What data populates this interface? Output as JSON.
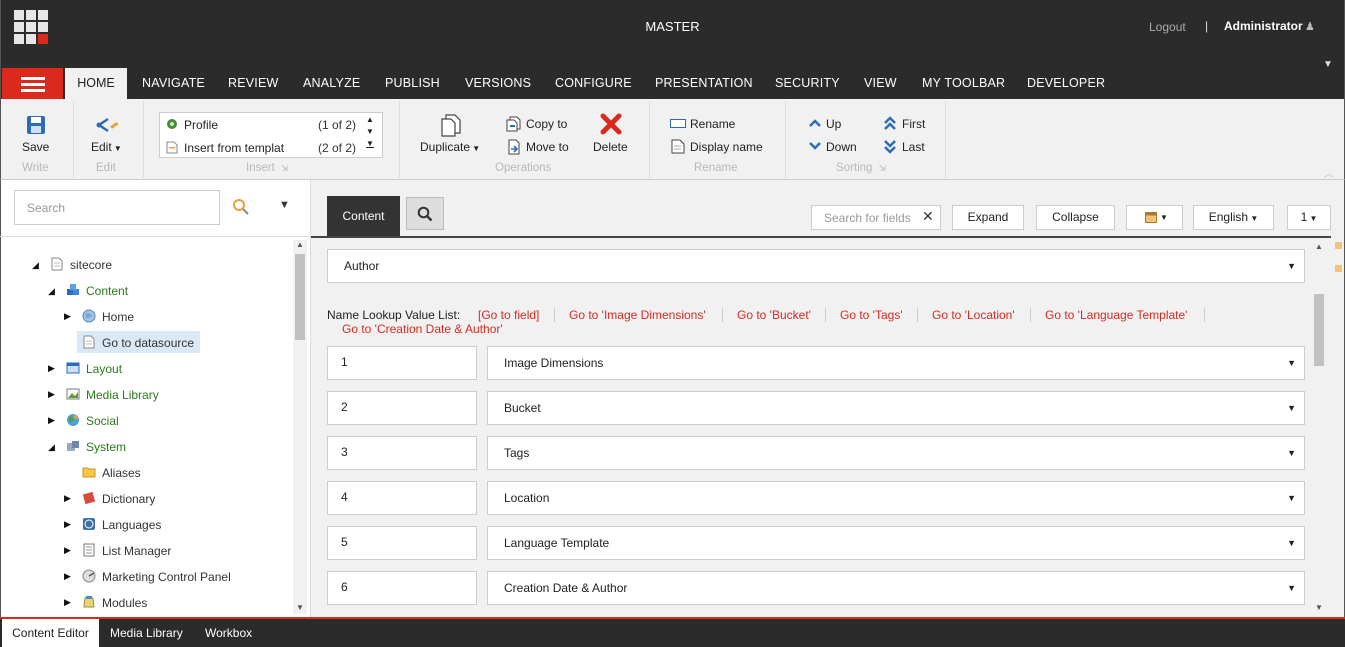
{
  "header": {
    "database": "MASTER",
    "logout": "Logout",
    "separator": "|",
    "user": "Administrator"
  },
  "ribbon_tabs": [
    "HOME",
    "NAVIGATE",
    "REVIEW",
    "ANALYZE",
    "PUBLISH",
    "VERSIONS",
    "CONFIGURE",
    "PRESENTATION",
    "SECURITY",
    "VIEW",
    "MY TOOLBAR",
    "DEVELOPER"
  ],
  "ribbon": {
    "write": {
      "label": "Write",
      "save": "Save"
    },
    "edit": {
      "label": "Edit",
      "edit": "Edit"
    },
    "insert": {
      "label": "Insert",
      "items": [
        {
          "name": "Profile",
          "count": "(1 of 2)"
        },
        {
          "name": "Insert from templat",
          "count": "(2 of 2)"
        }
      ]
    },
    "operations": {
      "label": "Operations",
      "duplicate": "Duplicate",
      "copy_to": "Copy to",
      "move_to": "Move to",
      "delete": "Delete"
    },
    "rename": {
      "label": "Rename",
      "rename": "Rename",
      "display_name": "Display name"
    },
    "sorting": {
      "label": "Sorting",
      "up": "Up",
      "down": "Down",
      "first": "First",
      "last": "Last"
    }
  },
  "tree": {
    "search_placeholder": "Search",
    "items": [
      {
        "label": "sitecore",
        "icon": "document-icon"
      },
      {
        "label": "Content",
        "icon": "content-cubes-icon"
      },
      {
        "label": "Home",
        "icon": "globe-icon"
      },
      {
        "label": "Go to datasource",
        "icon": "document-icon"
      },
      {
        "label": "Layout",
        "icon": "layout-icon"
      },
      {
        "label": "Media Library",
        "icon": "image-icon"
      },
      {
        "label": "Social",
        "icon": "social-globe-icon"
      },
      {
        "label": "System",
        "icon": "system-icon"
      },
      {
        "label": "Aliases",
        "icon": "folder-icon"
      },
      {
        "label": "Dictionary",
        "icon": "book-icon"
      },
      {
        "label": "Languages",
        "icon": "language-icon"
      },
      {
        "label": "List Manager",
        "icon": "list-icon"
      },
      {
        "label": "Marketing Control Panel",
        "icon": "marketing-icon"
      },
      {
        "label": "Modules",
        "icon": "modules-icon"
      }
    ]
  },
  "editor": {
    "tab_content": "Content",
    "field_search_placeholder": "Search for fields",
    "expand": "Expand",
    "collapse": "Collapse",
    "language": "English",
    "version": "1",
    "template_select": "Author",
    "name_lookup_label": "Name Lookup Value List:",
    "links": [
      "[Go to field]",
      "Go to 'Image Dimensions'",
      "Go to 'Bucket'",
      "Go to 'Tags'",
      "Go to 'Location'",
      "Go to 'Language Template'",
      "Go to 'Creation Date & Author'"
    ],
    "rows": [
      {
        "key": "1",
        "value": "Image Dimensions"
      },
      {
        "key": "2",
        "value": "Bucket"
      },
      {
        "key": "3",
        "value": "Tags"
      },
      {
        "key": "4",
        "value": "Location"
      },
      {
        "key": "5",
        "value": "Language Template"
      },
      {
        "key": "6",
        "value": "Creation Date & Author"
      }
    ]
  },
  "bottom_tabs": [
    "Content Editor",
    "Media Library",
    "Workbox"
  ],
  "colors": {
    "accent": "#dc291e",
    "dark": "#2b2b2b",
    "link": "#dc291e",
    "tree_green": "#2b7a1b"
  }
}
